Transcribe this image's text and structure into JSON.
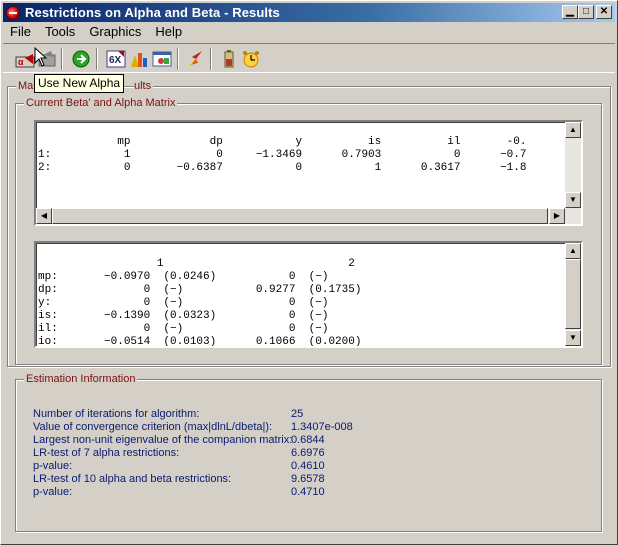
{
  "window": {
    "title": "Restrictions on Alpha and Beta - Results"
  },
  "menu": [
    "File",
    "Tools",
    "Graphics",
    "Help"
  ],
  "toolbar": {
    "icons": [
      "alpha-open-icon",
      "use-new-alpha-icon",
      "go-icon",
      "six-x-icon",
      "bar-chart-icon",
      "plot-window-icon",
      "rocket-icon",
      "battery-icon",
      "alarm-clock-icon"
    ]
  },
  "tooltip": "Use New Alpha",
  "outer_group": {
    "label_prefix": "Ma",
    "label_suffix": "ults"
  },
  "beta_group": {
    "label": "Current Beta' and Alpha Matrix",
    "beta_header": [
      "mp",
      "dp",
      "y",
      "is",
      "il",
      "-0."
    ],
    "beta_rows": [
      {
        "label": "1:",
        "values": [
          "1",
          "0",
          "−1.3469",
          "0.7903",
          "0",
          "−0.7"
        ]
      },
      {
        "label": "2:",
        "values": [
          "0",
          "−0.6387",
          "0",
          "1",
          "0.3617",
          "−1.8"
        ]
      }
    ],
    "alpha_header": [
      "1",
      "2"
    ],
    "alpha_rows": [
      {
        "label": "mp:",
        "c1": "−0.0970",
        "s1": "(0.0246)",
        "c2": "0",
        "s2": "(−)"
      },
      {
        "label": "dp:",
        "c1": "0",
        "s1": "(−)",
        "c2": "0.9277",
        "s2": "(0.1735)"
      },
      {
        "label": "y:",
        "c1": "0",
        "s1": "(−)",
        "c2": "0",
        "s2": "(−)"
      },
      {
        "label": "is:",
        "c1": "−0.1390",
        "s1": "(0.0323)",
        "c2": "0",
        "s2": "(−)"
      },
      {
        "label": "il:",
        "c1": "0",
        "s1": "(−)",
        "c2": "0",
        "s2": "(−)"
      },
      {
        "label": "io:",
        "c1": "−0.0514",
        "s1": "(0.0103)",
        "c2": "0.1066",
        "s2": "(0.0200)"
      }
    ]
  },
  "estimation": {
    "label": "Estimation Information",
    "rows": [
      {
        "label": "Number of iterations for algorithm:",
        "value": "25"
      },
      {
        "label": "Value of convergence criterion (max|dlnL/dbeta|):",
        "value": "1.3407e-008"
      },
      {
        "label": "Largest non-unit eigenvalue of the companion matrix:",
        "value": "0.6844"
      },
      {
        "label": "LR-test of 7 alpha restrictions:",
        "value": "6.6976"
      },
      {
        "label": "p-value:",
        "value": "0.4610"
      },
      {
        "label": "LR-test of 10 alpha and beta restrictions:",
        "value": "9.6578"
      },
      {
        "label": "p-value:",
        "value": "0.4710"
      }
    ]
  }
}
